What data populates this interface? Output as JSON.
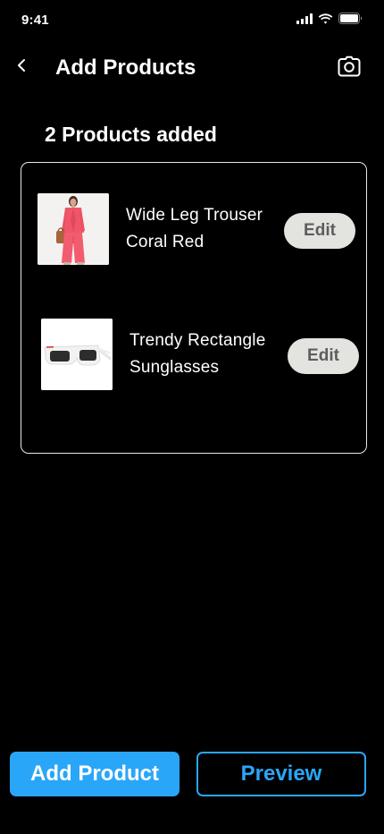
{
  "status_bar": {
    "time": "9:41",
    "icons": [
      "signal-icon",
      "wifi-icon",
      "battery-icon"
    ]
  },
  "header": {
    "back_icon": "chevron-left-icon",
    "title": "Add Products",
    "camera_icon": "camera-icon"
  },
  "summary": {
    "count_label": "2 Products added"
  },
  "products": [
    {
      "name_line1": "Wide Leg Trouser",
      "name_line2": "Coral Red",
      "image_icon": "coral-suit-photo",
      "edit_label": "Edit"
    },
    {
      "name_line1": "Trendy Rectangle",
      "name_line2": "Sunglasses",
      "image_icon": "white-sunglasses-photo",
      "edit_label": "Edit"
    }
  ],
  "footer": {
    "add_label": "Add Product",
    "preview_label": "Preview"
  },
  "colors": {
    "background": "#000000",
    "accent": "#2aa6f8",
    "edit_button": "#e3e3df",
    "edit_text": "#5d5d5d",
    "card_border": "#e8e8e8"
  }
}
